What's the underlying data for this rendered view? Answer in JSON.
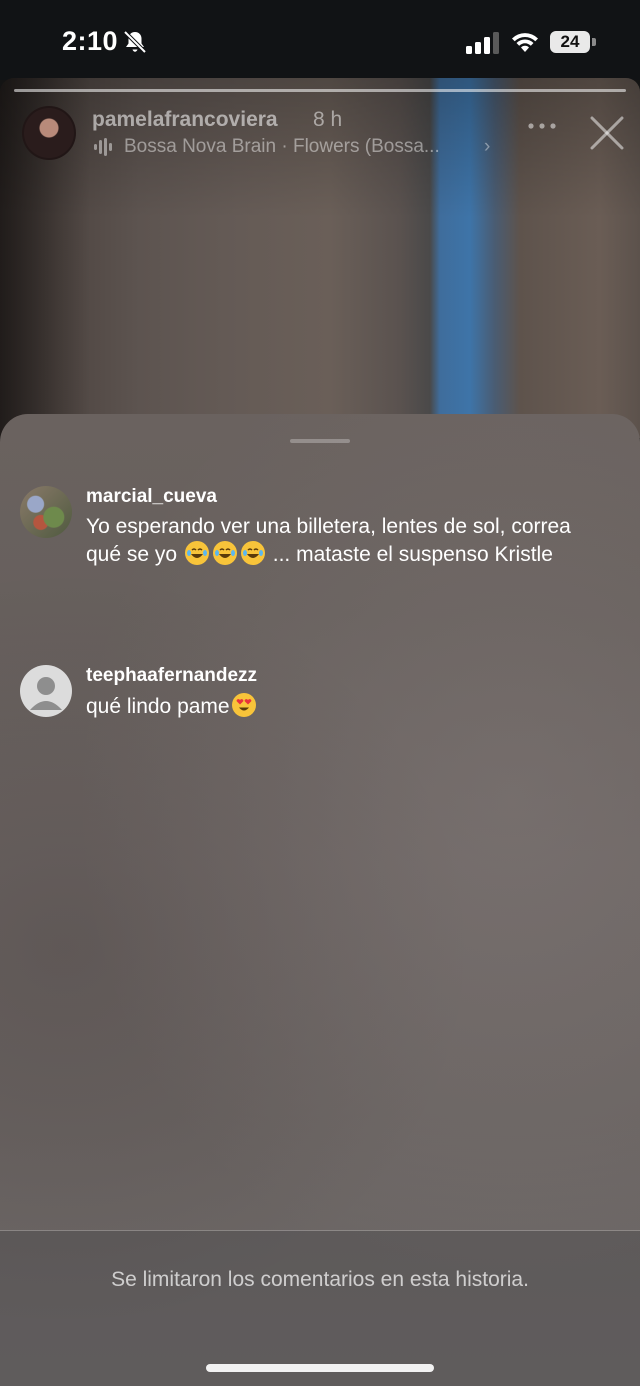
{
  "status_bar": {
    "time": "2:10",
    "battery": "24",
    "bell_icon": "bell-slash-icon"
  },
  "story": {
    "username": "pamelafrancoviera",
    "time_ago": "8 h",
    "music": "Bossa Nova Brain · Flowers (Bossa...",
    "chevron": "›"
  },
  "comments": [
    {
      "user": "marcial_cueva",
      "text_before": "Yo esperando ver una billetera, lentes de sol, correa  qué se yo ",
      "emojis": [
        "joy",
        "joy",
        "joy"
      ],
      "text_after": " ... mataste el suspenso Kristle"
    },
    {
      "user": "teephaafernandezz",
      "text_before": "qué lindo pame",
      "emojis": [
        "heart-eyes"
      ],
      "text_after": ""
    }
  ],
  "footer": {
    "text": "Se limitaron los comentarios en esta historia."
  },
  "colors": {
    "accent": "#ffffff",
    "sheet": "#6a625f",
    "status_bar": "#111315"
  }
}
